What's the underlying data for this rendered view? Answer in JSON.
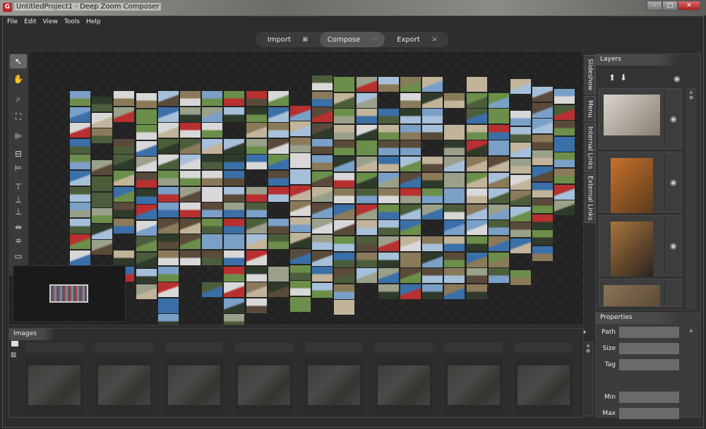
{
  "window": {
    "title": "UntitledProject1 - Deep Zoom Composer",
    "app_icon": "G",
    "minimize": "–",
    "maximize": "□",
    "close": "✕"
  },
  "menu": [
    "File",
    "Edit",
    "View",
    "Tools",
    "Help"
  ],
  "modes": [
    {
      "label": "Import",
      "icon": "▣"
    },
    {
      "label": "Compose",
      "icon": "☜"
    },
    {
      "label": "Export",
      "icon": "⇲"
    }
  ],
  "active_mode": "Compose",
  "tools": [
    "↖",
    "✋",
    "⌕",
    "⛶",
    "⊫",
    "⊟",
    "⊨",
    "⊤",
    "⊥",
    "⊥",
    "⇹",
    "≑",
    "▭",
    "▯"
  ],
  "side_tabs": [
    "Slideshow",
    "Menu",
    "Internal Links",
    "External Links"
  ],
  "layers": {
    "title": "Layers",
    "up": "⬆",
    "down": "⬇",
    "eye": "◉",
    "items": [
      {
        "colors": [
          "#d8d4cc",
          "#8a7d70"
        ]
      },
      {
        "colors": [
          "#c9702a",
          "#5a3b1e"
        ]
      },
      {
        "colors": [
          "#a8743a",
          "#2b2420"
        ]
      },
      {
        "colors": [
          "#8a7356",
          "#4a3a2a"
        ]
      }
    ]
  },
  "properties": {
    "title": "Properties",
    "fields": [
      "Path",
      "Size",
      "Tag",
      "Min",
      "Max"
    ]
  },
  "images": {
    "title": "Images",
    "count": 8
  },
  "colors": {
    "accent": "#c0262a",
    "bg": "#2d2d2d"
  }
}
